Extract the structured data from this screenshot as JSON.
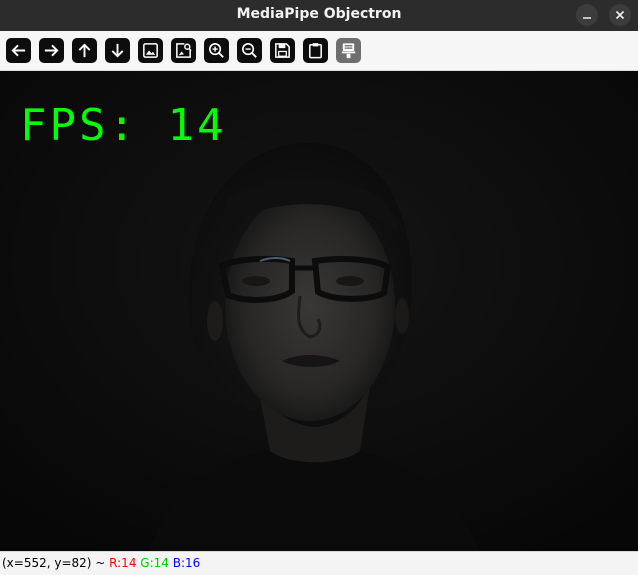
{
  "window": {
    "title": "MediaPipe Objectron",
    "minimize_icon": "minimize-icon",
    "close_icon": "close-icon"
  },
  "toolbar": {
    "buttons": [
      {
        "icon": "arrow-left-icon",
        "name": "pan-left-button"
      },
      {
        "icon": "arrow-right-icon",
        "name": "pan-right-button"
      },
      {
        "icon": "arrow-up-icon",
        "name": "pan-up-button"
      },
      {
        "icon": "arrow-down-icon",
        "name": "pan-down-button"
      },
      {
        "icon": "image-icon",
        "name": "zoom-fit-button"
      },
      {
        "icon": "image-search-icon",
        "name": "zoom-original-button"
      },
      {
        "icon": "zoom-in-icon",
        "name": "zoom-in-button"
      },
      {
        "icon": "zoom-out-icon",
        "name": "zoom-out-button"
      },
      {
        "icon": "save-icon",
        "name": "save-button"
      },
      {
        "icon": "clipboard-icon",
        "name": "copy-to-clipboard-button"
      },
      {
        "icon": "properties-icon",
        "name": "properties-button"
      }
    ]
  },
  "overlay": {
    "fps_text": "FPS: 14",
    "fps_color": "#00ff00"
  },
  "status": {
    "coords": "(x=552, y=82) ~ ",
    "r": "R:14",
    "g": "G:14",
    "b": "B:16"
  },
  "colors": {
    "titlebar": "#2c2c2c",
    "toolbar": "#f6f6f6",
    "status_r": "#ff0000",
    "status_g": "#00cc00",
    "status_b": "#0000ff"
  }
}
